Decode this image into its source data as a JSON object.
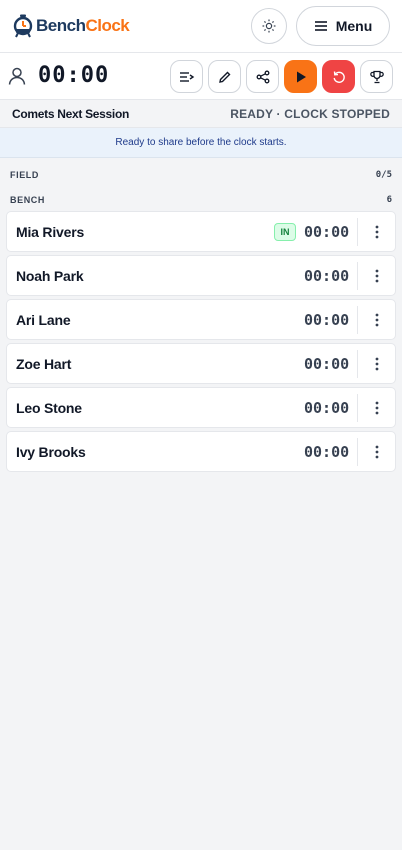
{
  "header": {
    "logo_bench": "Bench",
    "logo_clock": "Clock",
    "menu_label": "Menu"
  },
  "toolbar": {
    "clock": "00:00"
  },
  "session": {
    "name": "Comets Next Session",
    "status": "READY · CLOCK STOPPED",
    "share_message": "Ready to share before the clock starts."
  },
  "sections": {
    "field_label": "FIELD",
    "field_count": "0/5",
    "bench_label": "BENCH",
    "bench_count": "6"
  },
  "players": [
    {
      "name": "Mia Rivers",
      "time": "00:00",
      "badge": "IN"
    },
    {
      "name": "Noah Park",
      "time": "00:00"
    },
    {
      "name": "Ari Lane",
      "time": "00:00"
    },
    {
      "name": "Zoe Hart",
      "time": "00:00"
    },
    {
      "name": "Leo Stone",
      "time": "00:00"
    },
    {
      "name": "Ivy Brooks",
      "time": "00:00"
    }
  ],
  "icons": {
    "logo": "clock-logo-icon",
    "theme": "sun-icon",
    "menu": "hamburger-icon",
    "user": "user-icon",
    "lineup": "list-arrow-icon",
    "edit": "pencil-icon",
    "share": "share-icon",
    "play": "play-icon",
    "reset": "reset-icon",
    "trophy": "trophy-icon",
    "row_menu": "kebab-icon"
  },
  "colors": {
    "accent": "#f97316",
    "danger": "#ef4444",
    "brand": "#1e3a5f",
    "in_badge": "#15803d"
  }
}
